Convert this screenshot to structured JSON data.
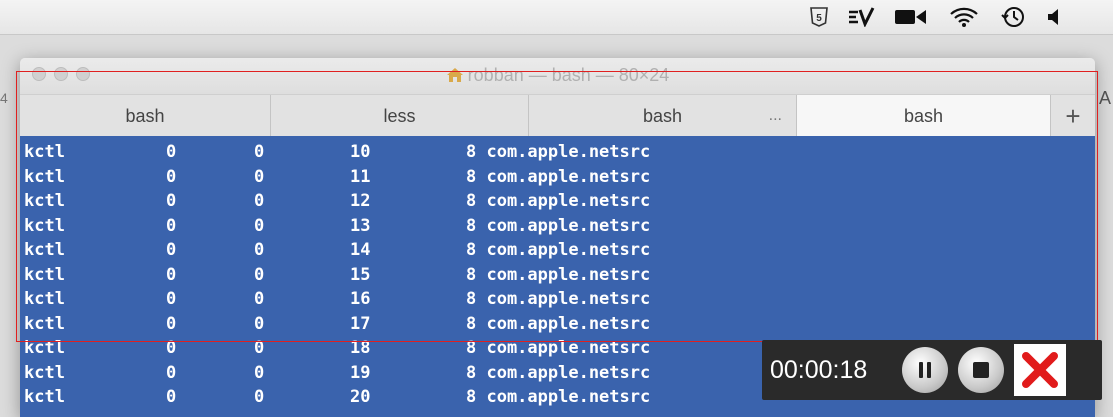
{
  "window": {
    "title": "robban — bash — 80×24"
  },
  "tabs": [
    {
      "label": "bash"
    },
    {
      "label": "less"
    },
    {
      "label": "bash",
      "more": "..."
    },
    {
      "label": "bash"
    }
  ],
  "new_tab_label": "+",
  "terminal": {
    "rows": [
      [
        "kctl",
        "0",
        "0",
        "10",
        "8 com.apple.netsrc"
      ],
      [
        "kctl",
        "0",
        "0",
        "11",
        "8 com.apple.netsrc"
      ],
      [
        "kctl",
        "0",
        "0",
        "12",
        "8 com.apple.netsrc"
      ],
      [
        "kctl",
        "0",
        "0",
        "13",
        "8 com.apple.netsrc"
      ],
      [
        "kctl",
        "0",
        "0",
        "14",
        "8 com.apple.netsrc"
      ],
      [
        "kctl",
        "0",
        "0",
        "15",
        "8 com.apple.netsrc"
      ],
      [
        "kctl",
        "0",
        "0",
        "16",
        "8 com.apple.netsrc"
      ],
      [
        "kctl",
        "0",
        "0",
        "17",
        "8 com.apple.netsrc"
      ],
      [
        "kctl",
        "0",
        "0",
        "18",
        "8 com.apple.netsrc"
      ],
      [
        "kctl",
        "0",
        "0",
        "19",
        "8 com.apple.netsrc"
      ],
      [
        "kctl",
        "0",
        "0",
        "20",
        "8 com.apple.netsrc"
      ]
    ]
  },
  "recorder": {
    "elapsed": "00:00:18"
  },
  "menubar": {
    "icons": [
      "html5-icon",
      "evernote-icon",
      "camera-icon",
      "wifi-icon",
      "time-machine-icon",
      "volume-icon"
    ]
  },
  "edge": {
    "right_char": "A",
    "left_char": "4"
  },
  "colors": {
    "terminal_bg": "#3a63ad",
    "record_frame": "#e02020"
  }
}
